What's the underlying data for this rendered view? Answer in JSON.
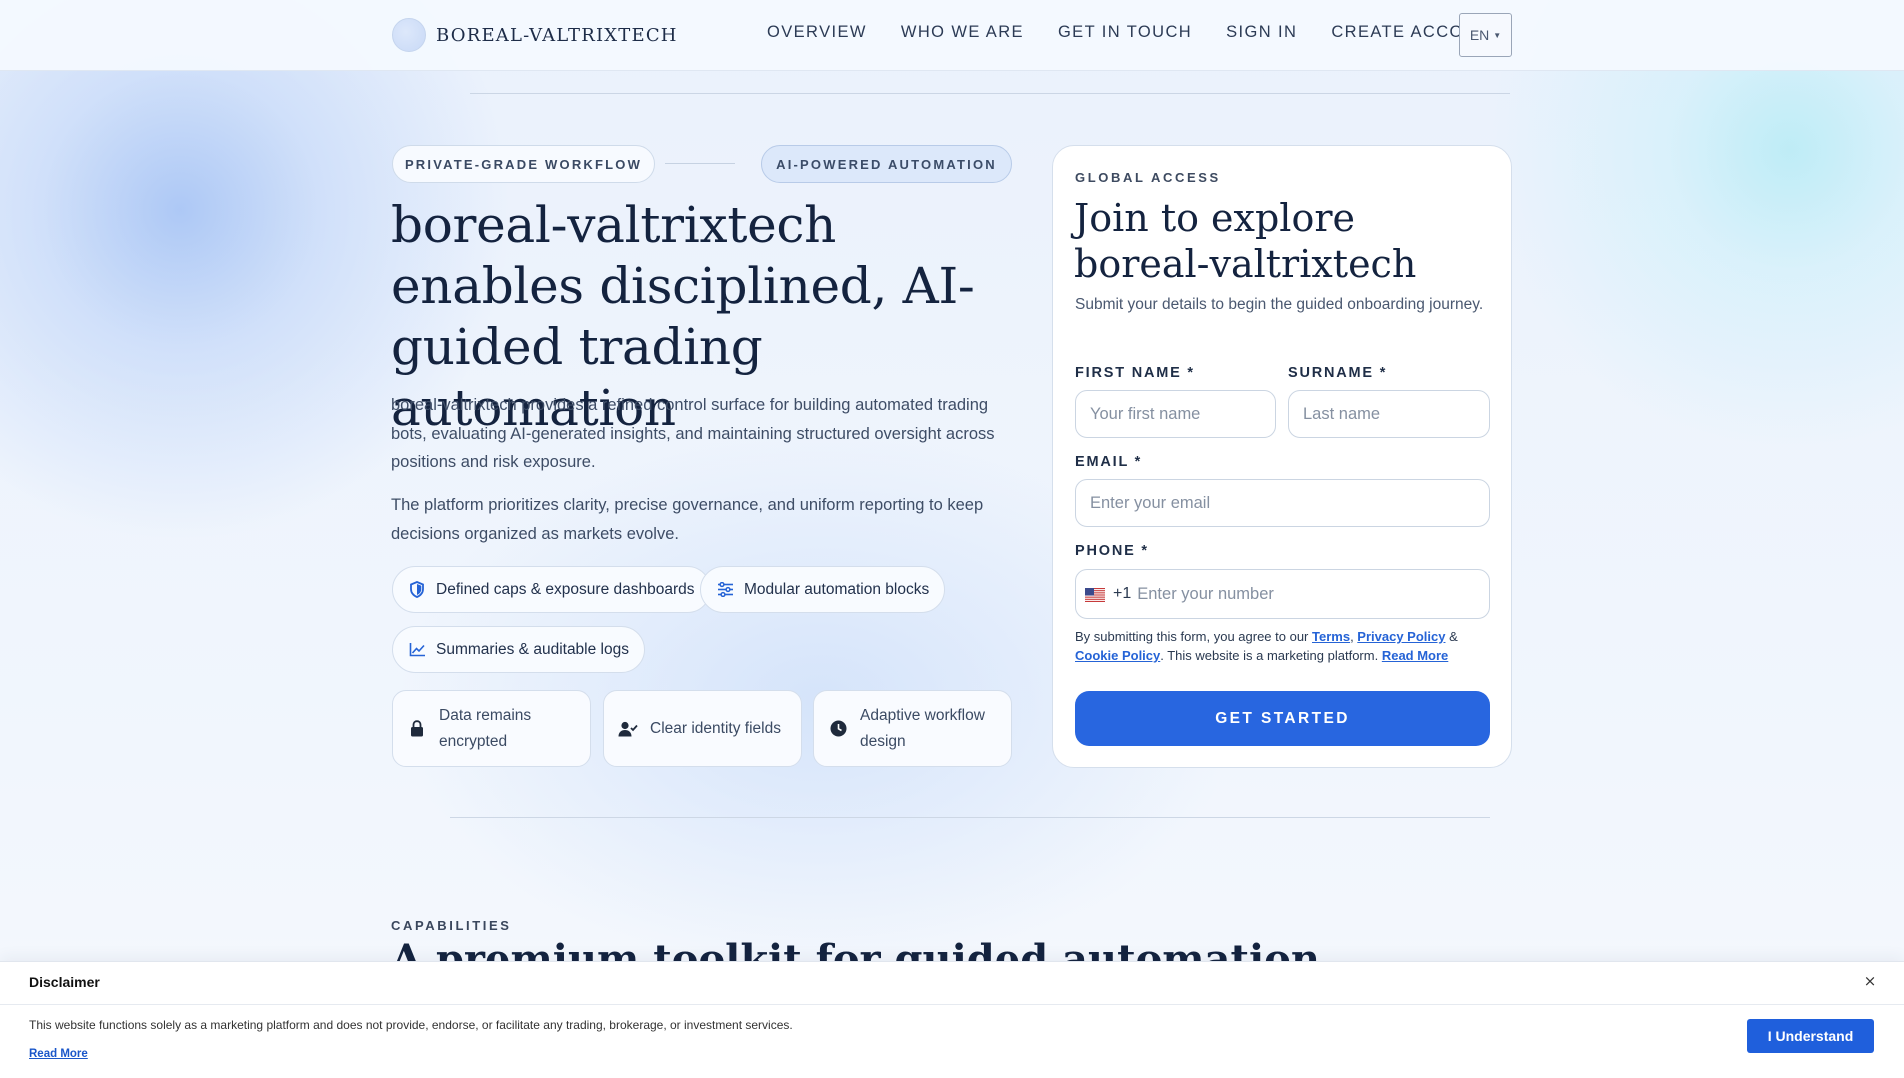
{
  "brand": {
    "name": "BOREAL-VALTRIXTECH"
  },
  "nav": {
    "items": [
      "OVERVIEW",
      "WHO WE ARE",
      "GET IN TOUCH",
      "SIGN IN",
      "CREATE ACCOUNT"
    ],
    "language": "EN"
  },
  "hero": {
    "tags": [
      "PRIVATE-GRADE WORKFLOW",
      "AI-POWERED AUTOMATION"
    ],
    "title": "boreal-valtrixtech enables disciplined, AI-guided trading automation",
    "paragraph1": "boreal-valtrixtech provides a refined control surface for building automated trading bots, evaluating AI-generated insights, and maintaining structured oversight across positions and risk exposure.",
    "paragraph2": "The platform prioritizes clarity, precise governance, and uniform reporting to keep decisions organized as markets evolve.",
    "pills": [
      {
        "label": "Defined caps & exposure dashboards",
        "icon": "shield-icon"
      },
      {
        "label": "Modular automation blocks",
        "icon": "sliders-icon"
      },
      {
        "label": "Summaries & auditable logs",
        "icon": "line-chart-icon"
      }
    ],
    "features": [
      {
        "label": "Data remains encrypted",
        "icon": "lock-icon"
      },
      {
        "label": "Clear identity fields",
        "icon": "user-check-icon"
      },
      {
        "label": "Adaptive workflow design",
        "icon": "clock-icon"
      }
    ]
  },
  "form": {
    "eyebrow": "GLOBAL ACCESS",
    "title": "Join to explore boreal-valtrixtech",
    "subtitle": "Submit your details to begin the guided onboarding journey.",
    "first_name": {
      "label": "FIRST NAME *",
      "placeholder": "Your first name",
      "value": ""
    },
    "surname": {
      "label": "SURNAME *",
      "placeholder": "Last name",
      "value": ""
    },
    "email": {
      "label": "EMAIL *",
      "placeholder": "Enter your email",
      "value": ""
    },
    "phone": {
      "label": "PHONE *",
      "dial_code": "+1",
      "country": "us-flag-icon",
      "placeholder": "Enter your number",
      "value": ""
    },
    "consent": {
      "prefix": "By submitting this form, you agree to our ",
      "terms": "Terms",
      "comma": ", ",
      "privacy": "Privacy Policy",
      "amp": " & ",
      "cookie": "Cookie Policy",
      "suffix": ". This website is a marketing platform. ",
      "read_more": "Read More"
    },
    "submit": "GET STARTED"
  },
  "capabilities": {
    "eyebrow": "CAPABILITIES",
    "title": "A premium toolkit for guided automation"
  },
  "disclaimer": {
    "title": "Disclaimer",
    "close": "×",
    "text": "This website functions solely as a marketing platform and does not provide, endorse, or facilitate any trading, brokerage, or investment services.",
    "read_more": "Read More",
    "accept": "I Understand"
  },
  "colors": {
    "accent": "#2866e0",
    "link": "#2563d6",
    "heading": "#14233f",
    "background": "#eef4fd"
  }
}
